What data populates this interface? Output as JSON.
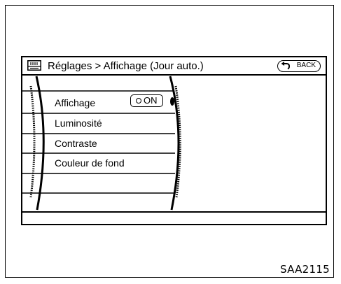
{
  "header": {
    "breadcrumb": "Réglages > Affichage (Jour auto.)",
    "icon": "display-settings-icon",
    "back_label": "BACK",
    "back_icon": "back-arrow-icon"
  },
  "menu": {
    "items": [
      {
        "label": "Affichage",
        "value": "ON",
        "value_icon": "radio-dot-icon"
      },
      {
        "label": "Luminosité"
      },
      {
        "label": "Contraste"
      },
      {
        "label": "Couleur de fond"
      },
      {
        "label": ""
      },
      {
        "label": ""
      }
    ],
    "scroll_indicator": "scroll-position-icon"
  },
  "figure_code": "SAA2115"
}
